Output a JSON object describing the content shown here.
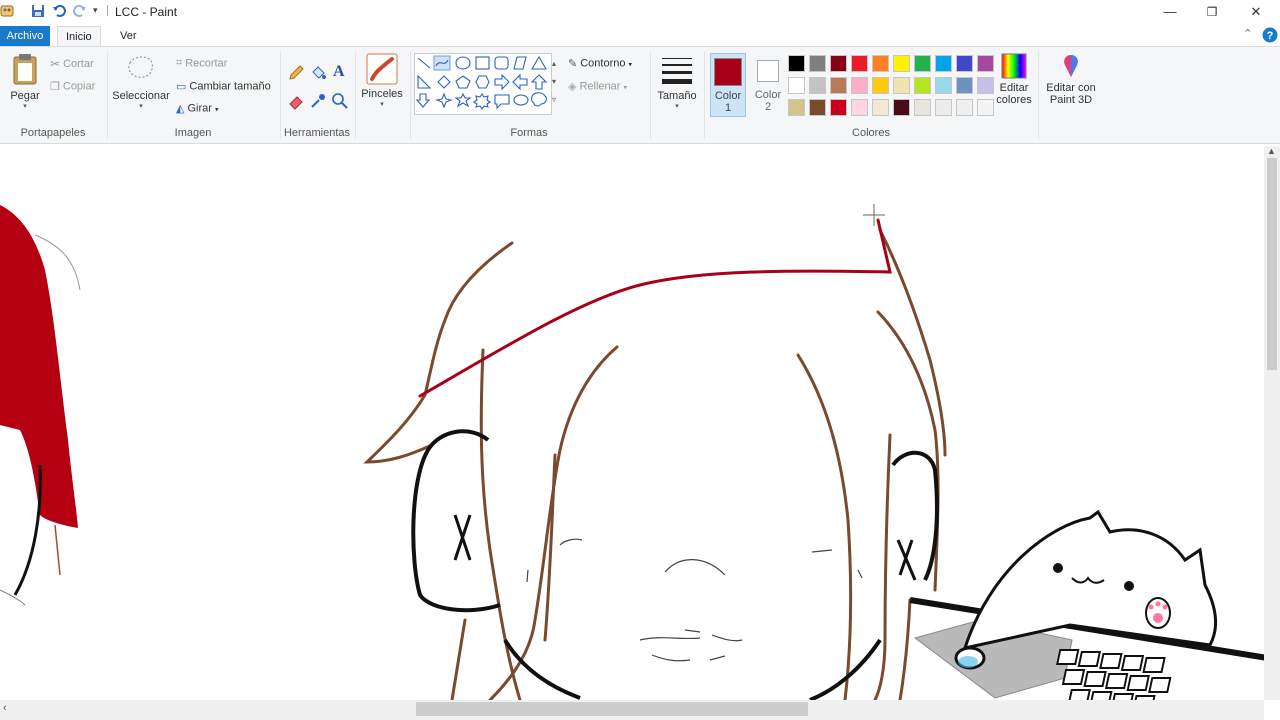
{
  "window": {
    "title": "LCC - Paint",
    "minimize": "—",
    "restore": "❐",
    "close": "✕"
  },
  "menu": {
    "file": "Archivo",
    "home": "Inicio",
    "view": "Ver"
  },
  "clipboard": {
    "paste": "Pegar",
    "cut": "Cortar",
    "copy": "Copiar",
    "label": "Portapapeles"
  },
  "image": {
    "select": "Seleccionar",
    "crop": "Recortar",
    "resize": "Cambiar tamaño",
    "rotate": "Girar",
    "label": "Imagen"
  },
  "tools": {
    "label": "Herramientas",
    "brushes": "Pinceles"
  },
  "shapes": {
    "outline": "Contorno",
    "fill": "Rellenar",
    "label": "Formas"
  },
  "size": {
    "label": "Tamaño"
  },
  "colors": {
    "color1_label": "Color",
    "color1_num": "1",
    "color2_label": "Color",
    "color2_num": "2",
    "edit_label_1": "Editar",
    "edit_label_2": "colores",
    "paint3d_1": "Editar con",
    "paint3d_2": "Paint 3D",
    "label": "Colores",
    "color1_value": "#a80018",
    "color2_value": "#ffffff",
    "palette_row1": [
      "#000000",
      "#7f7f7f",
      "#880015",
      "#ed1c24",
      "#ff7f27",
      "#fff200",
      "#22b14c",
      "#00a2e8",
      "#3f48cc",
      "#a349a4"
    ],
    "palette_row2": [
      "#ffffff",
      "#c3c3c3",
      "#b97a57",
      "#ffaec9",
      "#ffc90e",
      "#efe4b0",
      "#b5e61d",
      "#99d9ea",
      "#7092be",
      "#c8bfe7"
    ],
    "palette_row3": [
      "#d2c48c",
      "#7a4b2a",
      "#c8001e",
      "#ffd6e0",
      "#f2e8d5",
      "#4a0a18",
      "#e8e6dc",
      "#ecece8",
      "#efefef",
      "#f4f4f4"
    ]
  }
}
